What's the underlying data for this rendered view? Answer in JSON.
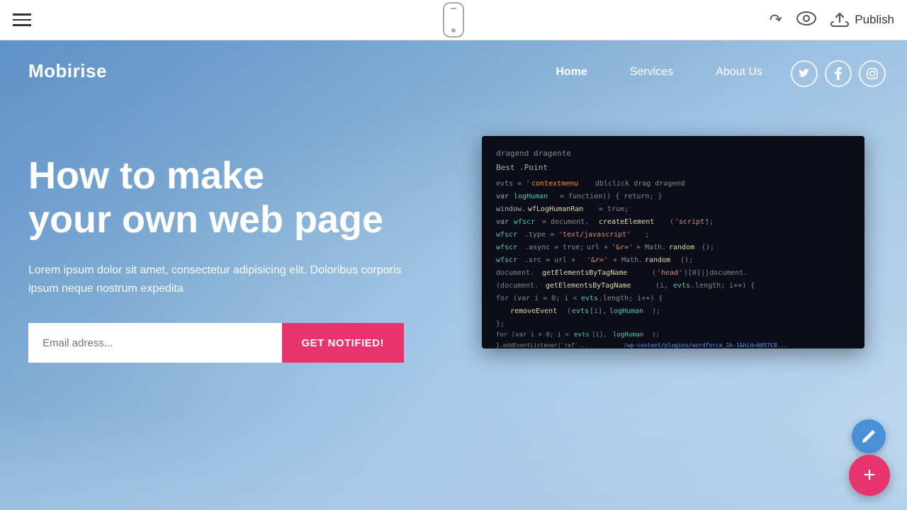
{
  "toolbar": {
    "hamburger_label": "menu",
    "publish_label": "Publish",
    "undo_symbol": "↩",
    "eye_symbol": "👁"
  },
  "nav": {
    "brand": "Mobirise",
    "links": [
      {
        "label": "Home",
        "active": true
      },
      {
        "label": "Services",
        "active": false
      },
      {
        "label": "About Us",
        "active": false
      }
    ],
    "socials": [
      {
        "name": "twitter",
        "symbol": "𝕏"
      },
      {
        "name": "facebook",
        "symbol": "f"
      },
      {
        "name": "instagram",
        "symbol": "⬡"
      }
    ]
  },
  "hero": {
    "title_line1": "How to make",
    "title_line2": "your own web page",
    "description": "Lorem ipsum dolor sit amet, consectetur adipisicing elit. Doloribus corporis ipsum neque nostrum expedita",
    "email_placeholder": "Email adress...",
    "cta_label": "GET NOTIFIED!"
  }
}
